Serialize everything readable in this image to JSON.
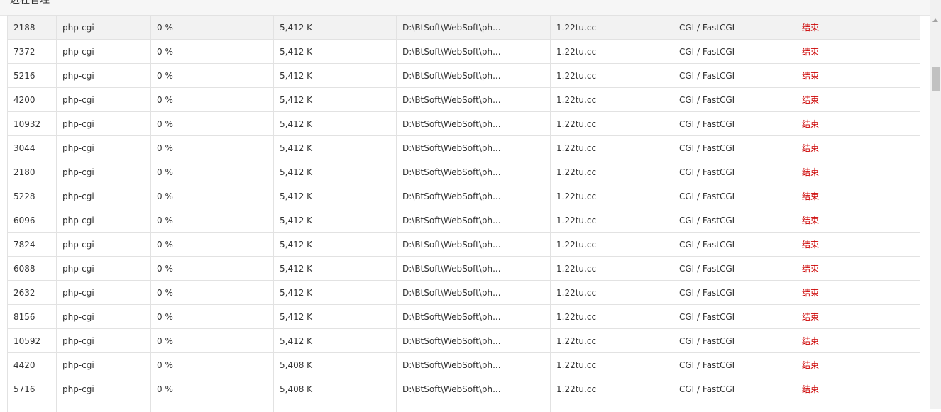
{
  "header": {
    "title": "进程管理"
  },
  "table": {
    "rows": [
      {
        "pid": "2188",
        "name": "php-cgi",
        "cpu": "0 %",
        "memory": "5,412 K",
        "path": "D:\\BtSoft\\WebSoft\\ph...",
        "site": "1.22tu.cc",
        "type": "CGI / FastCGI",
        "action": "结束"
      },
      {
        "pid": "7372",
        "name": "php-cgi",
        "cpu": "0 %",
        "memory": "5,412 K",
        "path": "D:\\BtSoft\\WebSoft\\ph...",
        "site": "1.22tu.cc",
        "type": "CGI / FastCGI",
        "action": "结束"
      },
      {
        "pid": "5216",
        "name": "php-cgi",
        "cpu": "0 %",
        "memory": "5,412 K",
        "path": "D:\\BtSoft\\WebSoft\\ph...",
        "site": "1.22tu.cc",
        "type": "CGI / FastCGI",
        "action": "结束"
      },
      {
        "pid": "4200",
        "name": "php-cgi",
        "cpu": "0 %",
        "memory": "5,412 K",
        "path": "D:\\BtSoft\\WebSoft\\ph...",
        "site": "1.22tu.cc",
        "type": "CGI / FastCGI",
        "action": "结束"
      },
      {
        "pid": "10932",
        "name": "php-cgi",
        "cpu": "0 %",
        "memory": "5,412 K",
        "path": "D:\\BtSoft\\WebSoft\\ph...",
        "site": "1.22tu.cc",
        "type": "CGI / FastCGI",
        "action": "结束"
      },
      {
        "pid": "3044",
        "name": "php-cgi",
        "cpu": "0 %",
        "memory": "5,412 K",
        "path": "D:\\BtSoft\\WebSoft\\ph...",
        "site": "1.22tu.cc",
        "type": "CGI / FastCGI",
        "action": "结束"
      },
      {
        "pid": "2180",
        "name": "php-cgi",
        "cpu": "0 %",
        "memory": "5,412 K",
        "path": "D:\\BtSoft\\WebSoft\\ph...",
        "site": "1.22tu.cc",
        "type": "CGI / FastCGI",
        "action": "结束"
      },
      {
        "pid": "5228",
        "name": "php-cgi",
        "cpu": "0 %",
        "memory": "5,412 K",
        "path": "D:\\BtSoft\\WebSoft\\ph...",
        "site": "1.22tu.cc",
        "type": "CGI / FastCGI",
        "action": "结束"
      },
      {
        "pid": "6096",
        "name": "php-cgi",
        "cpu": "0 %",
        "memory": "5,412 K",
        "path": "D:\\BtSoft\\WebSoft\\ph...",
        "site": "1.22tu.cc",
        "type": "CGI / FastCGI",
        "action": "结束"
      },
      {
        "pid": "7824",
        "name": "php-cgi",
        "cpu": "0 %",
        "memory": "5,412 K",
        "path": "D:\\BtSoft\\WebSoft\\ph...",
        "site": "1.22tu.cc",
        "type": "CGI / FastCGI",
        "action": "结束"
      },
      {
        "pid": "6088",
        "name": "php-cgi",
        "cpu": "0 %",
        "memory": "5,412 K",
        "path": "D:\\BtSoft\\WebSoft\\ph...",
        "site": "1.22tu.cc",
        "type": "CGI / FastCGI",
        "action": "结束"
      },
      {
        "pid": "2632",
        "name": "php-cgi",
        "cpu": "0 %",
        "memory": "5,412 K",
        "path": "D:\\BtSoft\\WebSoft\\ph...",
        "site": "1.22tu.cc",
        "type": "CGI / FastCGI",
        "action": "结束"
      },
      {
        "pid": "8156",
        "name": "php-cgi",
        "cpu": "0 %",
        "memory": "5,412 K",
        "path": "D:\\BtSoft\\WebSoft\\ph...",
        "site": "1.22tu.cc",
        "type": "CGI / FastCGI",
        "action": "结束"
      },
      {
        "pid": "10592",
        "name": "php-cgi",
        "cpu": "0 %",
        "memory": "5,412 K",
        "path": "D:\\BtSoft\\WebSoft\\ph...",
        "site": "1.22tu.cc",
        "type": "CGI / FastCGI",
        "action": "结束"
      },
      {
        "pid": "4420",
        "name": "php-cgi",
        "cpu": "0 %",
        "memory": "5,408 K",
        "path": "D:\\BtSoft\\WebSoft\\ph...",
        "site": "1.22tu.cc",
        "type": "CGI / FastCGI",
        "action": "结束"
      },
      {
        "pid": "5716",
        "name": "php-cgi",
        "cpu": "0 %",
        "memory": "5,408 K",
        "path": "D:\\BtSoft\\WebSoft\\ph...",
        "site": "1.22tu.cc",
        "type": "CGI / FastCGI",
        "action": "结束"
      },
      {
        "pid": "",
        "name": "",
        "cpu": "",
        "memory": "",
        "path": "",
        "site": "",
        "type": "",
        "action": ""
      }
    ]
  },
  "colors": {
    "header_bg": "#f6f6f6",
    "highlight_row_bg": "#f2f2f2",
    "border": "#e2e2e2",
    "text": "#333333",
    "kill_action": "#cc0000",
    "scrollbar_track": "#f1f1f1",
    "scrollbar_thumb": "#c1c1c1"
  }
}
